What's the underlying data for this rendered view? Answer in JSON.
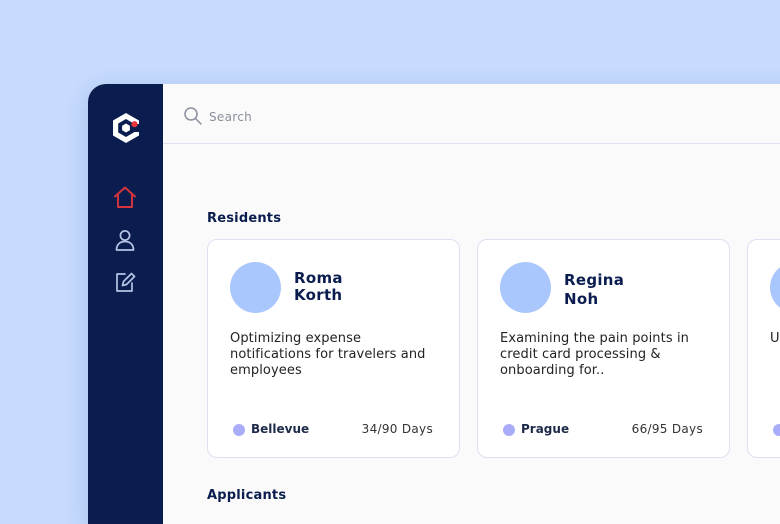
{
  "search": {
    "placeholder": "Search",
    "value": ""
  },
  "sidebar": {
    "logo": "brand-logo",
    "items": [
      {
        "icon": "home-icon",
        "active": true
      },
      {
        "icon": "user-icon",
        "active": false
      },
      {
        "icon": "edit-icon",
        "active": false
      }
    ]
  },
  "sections": {
    "residents": "Residents",
    "applicants": "Applicants"
  },
  "residents": [
    {
      "first_name": "Roma",
      "last_name": "Korth",
      "description": "Optimizing expense notifications for travelers and employees",
      "location": "Bellevue",
      "days": "34/90 Days"
    },
    {
      "first_name": "Regina",
      "last_name": "Noh",
      "description": "Examining the pain points in credit card processing & onboarding for..",
      "location": "Prague",
      "days": "66/95 Days"
    },
    {
      "first_name": "",
      "last_name": "",
      "description": "U d",
      "location": "",
      "days": ""
    }
  ],
  "colors": {
    "sidebar_bg": "#0b1d4f",
    "active_icon": "#d8343c",
    "inactive_icon": "#b6c4e6",
    "avatar": "#a9c7fd",
    "location_dot": "#a9acf8",
    "page_bg": "#c7dbfe"
  }
}
